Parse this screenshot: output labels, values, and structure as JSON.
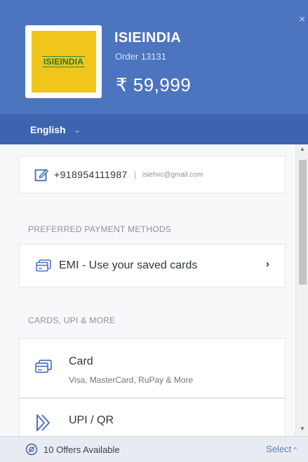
{
  "header": {
    "close_glyph": "×",
    "logo_text": "ISIEINDIA",
    "merchant_name": "ISIEINDIA",
    "order_label": "Order 13131",
    "amount": "₹ 59,999",
    "brand_color": "#4d74bf"
  },
  "language": {
    "selected": "English",
    "chevron": "⌄"
  },
  "contact": {
    "phone": "+918954111987",
    "separator": "|",
    "email": "isiehvc@gmail.com",
    "icon": "edit-icon"
  },
  "sections": {
    "preferred_title": "PREFERRED PAYMENT METHODS",
    "cards_title": "CARDS, UPI & MORE"
  },
  "preferred_methods": [
    {
      "label": "EMI - Use your saved cards",
      "icon": "card-icon",
      "arrow": "›"
    }
  ],
  "methods": [
    {
      "title": "Card",
      "subtitle": "Visa, MasterCard, RuPay & More",
      "icon": "card-icon"
    },
    {
      "title": "UPI / QR",
      "icon": "upi-icon"
    }
  ],
  "footer": {
    "offers": "10 Offers Available",
    "select": "Select",
    "select_chevron": "^",
    "icon": "offer-icon"
  },
  "scrollbar": {
    "up": "▲",
    "down": "▼"
  }
}
